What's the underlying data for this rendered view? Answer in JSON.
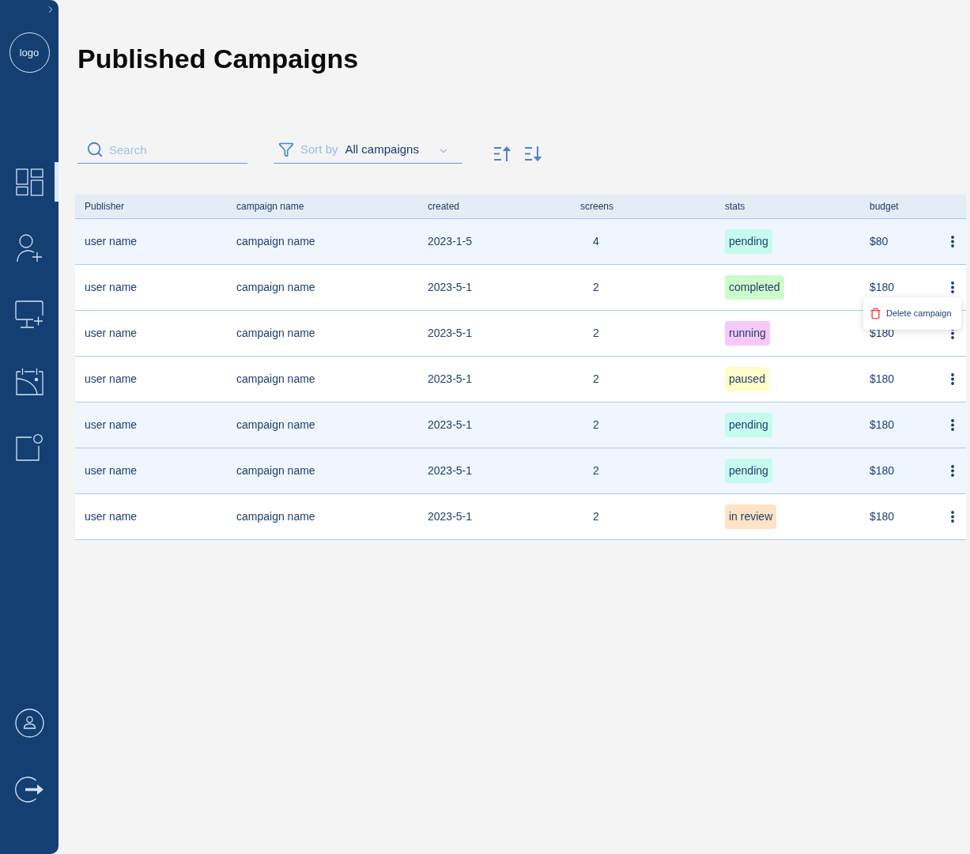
{
  "sidebar": {
    "logo": "logo",
    "nav": [
      {
        "selected": true
      },
      {
        "selected": false
      },
      {
        "selected": false
      },
      {
        "selected": false
      },
      {
        "selected": false
      }
    ]
  },
  "page": {
    "title": "Published Campaigns"
  },
  "toolbar": {
    "search": {
      "placeholder": "Search"
    },
    "sort": {
      "label": "Sort by",
      "value": "All campaigns"
    }
  },
  "table": {
    "columns": [
      "Publisher",
      "campaign name",
      "created",
      "screens",
      "stats",
      "budget"
    ],
    "rows": [
      {
        "publisher": "user name",
        "campaign": "campaign name",
        "created": "2023-1-5",
        "screens": "4",
        "status": {
          "label": "pending",
          "color": "#c6fcee"
        },
        "budget": "$80",
        "selected": true
      },
      {
        "publisher": "user name",
        "campaign": "campaign name",
        "created": "2023-5-1",
        "screens": "2",
        "status": {
          "label": "completed",
          "color": "#cdfccb"
        },
        "budget": "$180",
        "selected": false,
        "menu": [
          {
            "label": "Delete campaign"
          }
        ]
      },
      {
        "publisher": "user name",
        "campaign": "campaign name",
        "created": "2023-5-1",
        "screens": "2",
        "status": {
          "label": "running",
          "color": "#f6c8fc"
        },
        "budget": "$180",
        "selected": false
      },
      {
        "publisher": "user name",
        "campaign": "campaign name",
        "created": "2023-5-1",
        "screens": "2",
        "status": {
          "label": "paused",
          "color": "#fefdc9"
        },
        "budget": "$180",
        "selected": false
      },
      {
        "publisher": "user name",
        "campaign": "campaign name",
        "created": "2023-5-1",
        "screens": "2",
        "status": {
          "label": "pending",
          "color": "#c6fcee"
        },
        "budget": "$180",
        "selected": true
      },
      {
        "publisher": "user name",
        "campaign": "campaign name",
        "created": "2023-5-1",
        "screens": "2",
        "status": {
          "label": "pending",
          "color": "#c6fcee"
        },
        "budget": "$180",
        "selected": true
      },
      {
        "publisher": "user name",
        "campaign": "campaign name",
        "created": "2023-5-1",
        "screens": "2",
        "status": {
          "label": "in review",
          "color": "#fee3c6"
        },
        "budget": "$180",
        "selected": false
      }
    ]
  }
}
